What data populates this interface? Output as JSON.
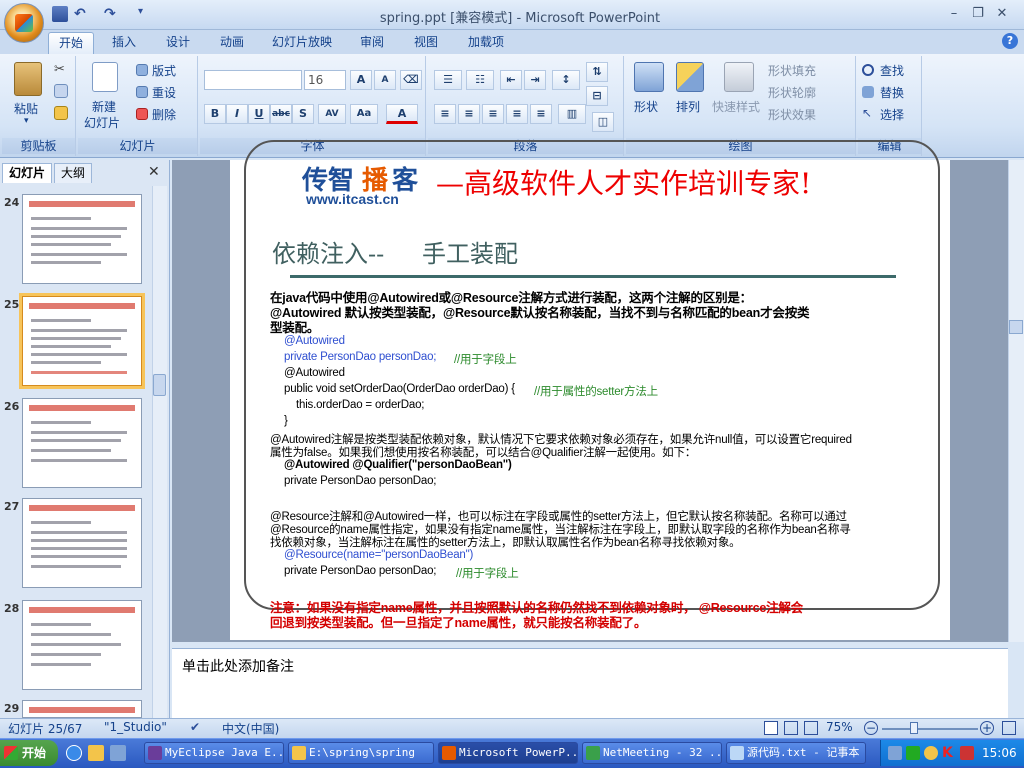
{
  "window": {
    "title": "spring.ppt [兼容模式] - Microsoft PowerPoint"
  },
  "tabs": [
    "开始",
    "插入",
    "设计",
    "动画",
    "幻灯片放映",
    "审阅",
    "视图",
    "加载项"
  ],
  "ribbon": {
    "clipboard": {
      "label": "剪贴板",
      "paste": "粘贴"
    },
    "slides": {
      "label": "幻灯片",
      "new_slide": "新建",
      "new_slide2": "幻灯片",
      "layout": "版式",
      "reset": "重设",
      "delete": "删除"
    },
    "font": {
      "label": "字体",
      "size": "16"
    },
    "paragraph": {
      "label": "段落"
    },
    "drawing": {
      "label": "绘图",
      "shapes": "形状",
      "arrange": "排列",
      "quick_styles": "快速样式",
      "fill": "形状填充",
      "outline": "形状轮廓",
      "effects": "形状效果"
    },
    "editing": {
      "label": "编辑",
      "find": "查找",
      "replace": "替换",
      "select": "选择"
    }
  },
  "panel": {
    "tab_slides": "幻灯片",
    "tab_outline": "大纲",
    "thumbs": [
      "24",
      "25",
      "26",
      "27",
      "28",
      "29"
    ]
  },
  "slide": {
    "logo_a": "传智",
    "logo_b": "播",
    "logo_c": "客",
    "logo_url": "www.itcast.cn",
    "slogan": "—高级软件人才实作培训专家!",
    "title_a": "依赖注入--",
    "title_b": "手工装配",
    "lines": [
      "在java代码中使用@Autowired或@Resource注解方式进行装配，这两个注解的区别是：",
      "@Autowired 默认按类型装配，@Resource默认按名称装配，当找不到与名称匹配的bean才会按类",
      "型装配。",
      "@Autowired",
      "private PersonDao  personDao;",
      "//用于字段上",
      "@Autowired",
      "public void setOrderDao(OrderDao orderDao) {",
      "//用于属性的setter方法上",
      "this.orderDao = orderDao;",
      "}",
      "@Autowired注解是按类型装配依赖对象，默认情况下它要求依赖对象必须存在，如果允许null值，可以设置它required",
      "属性为false。如果我们想使用按名称装配，可以结合@Qualifier注解一起使用。如下：",
      "@Autowired  @Qualifier(\"personDaoBean\")",
      "private PersonDao  personDao;",
      "@Resource注解和@Autowired一样，也可以标注在字段或属性的setter方法上，但它默认按名称装配。名称可以通过",
      "@Resource的name属性指定，如果没有指定name属性，当注解标注在字段上，即默认取字段的名称作为bean名称寻",
      "找依赖对象，当注解标注在属性的setter方法上，即默认取属性名作为bean名称寻找依赖对象。",
      "@Resource(name=\"personDaoBean\")",
      "private PersonDao  personDao;",
      "//用于字段上",
      "注意：如果没有指定name属性，并且按照默认的名称仍然找不到依赖对象时， @Resource注解会",
      "回退到按类型装配。但一旦指定了name属性，就只能按名称装配了。"
    ]
  },
  "notes": {
    "placeholder": "单击此处添加备注"
  },
  "status": {
    "slide": "幻灯片 25/67",
    "theme": "\"1_Studio\"",
    "lang": "中文(中国)",
    "zoom": "75%"
  },
  "taskbar": {
    "start": "开始",
    "items": [
      "MyEclipse Java E...",
      "E:\\spring\\spring",
      "Microsoft PowerP...",
      "NetMeeting - 32 ...",
      "源代码.txt - 记事本"
    ],
    "clock": "15:06"
  },
  "colors": {
    "accent": "#15428b",
    "ribbon": "#d5e4f6",
    "slide_red": "#d40000",
    "taskbar": "#2a58c0"
  }
}
